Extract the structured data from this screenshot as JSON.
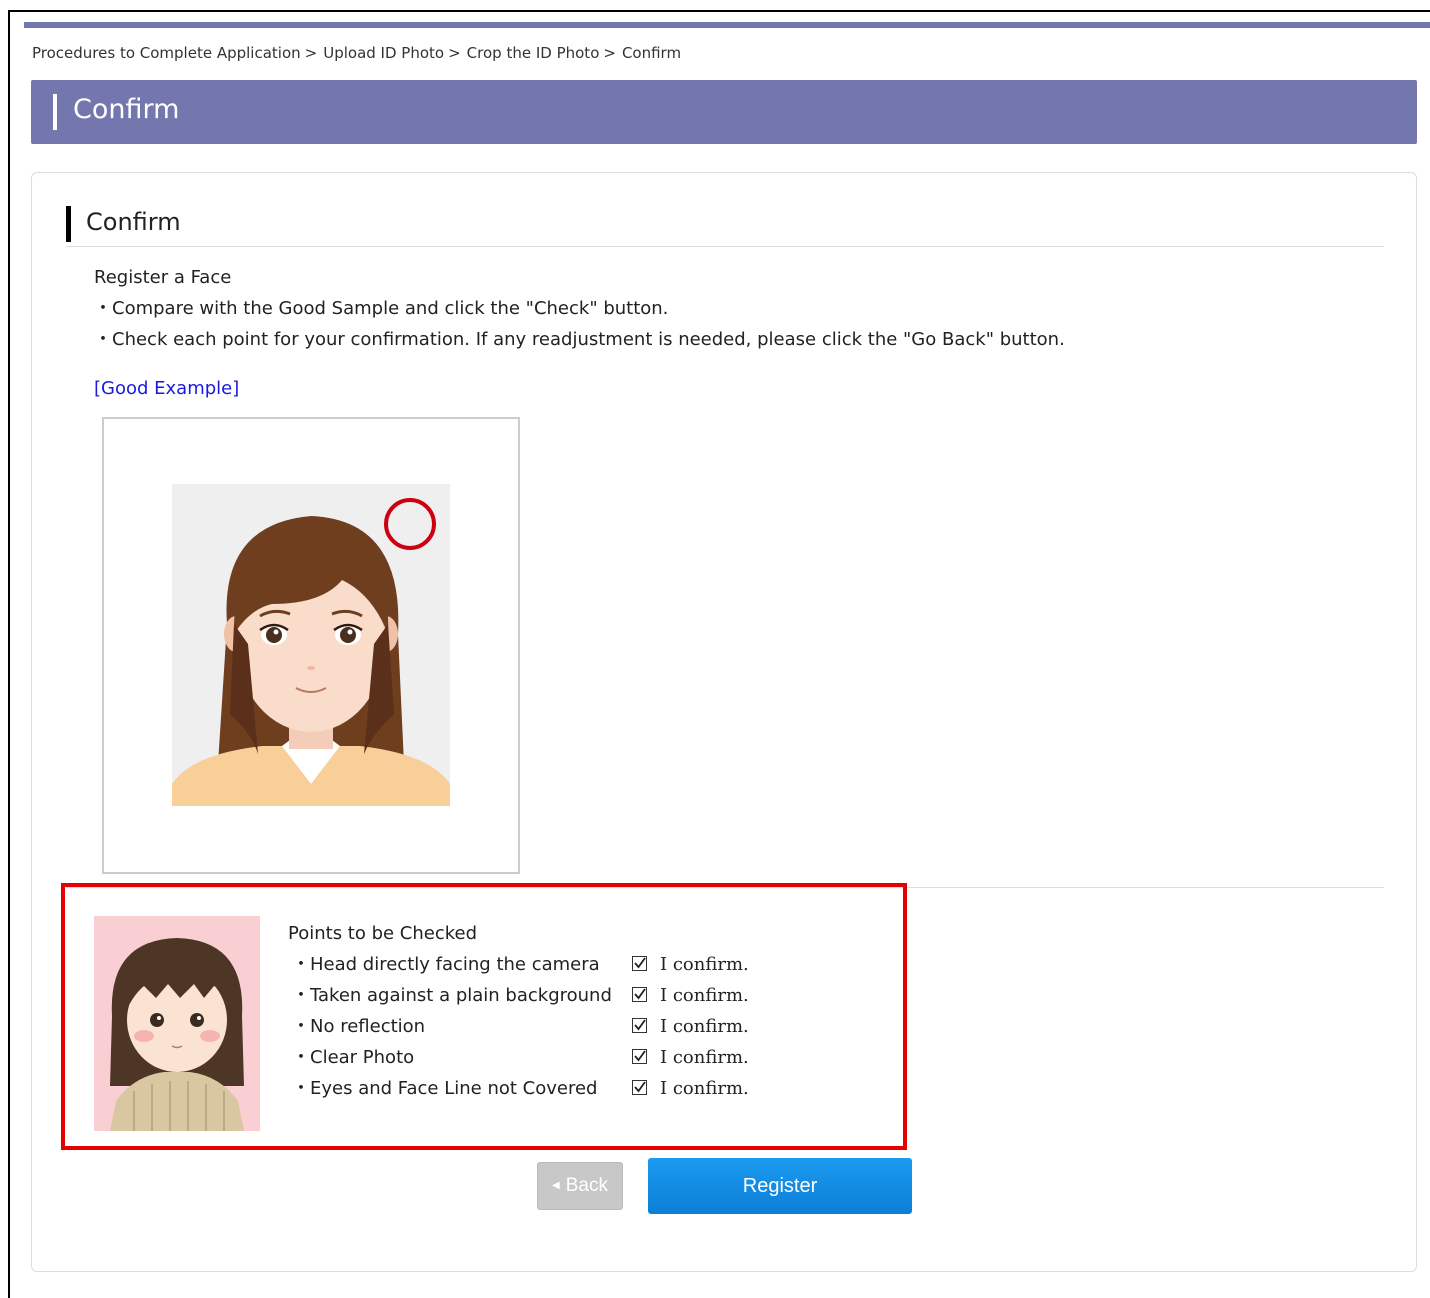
{
  "breadcrumb": {
    "items": [
      "Procedures to Complete Application",
      "Upload ID Photo",
      "Crop the ID Photo",
      "Confirm"
    ],
    "separator": ">"
  },
  "page_title": "Confirm",
  "section": {
    "title": "Confirm",
    "intro": {
      "heading": "Register a Face",
      "line1": "・Compare with the Good Sample and click the \"Check\" button.",
      "line2": "・Check each point for your confirmation. If any readjustment is needed, please click the \"Go Back\" button."
    },
    "good_example_link": "[Good Example]"
  },
  "checks": {
    "title": "Points to be Checked",
    "items": [
      {
        "label": "・Head directly facing the camera",
        "confirm": "I confirm.",
        "checked": true
      },
      {
        "label": "・Taken against a plain background",
        "confirm": "I confirm.",
        "checked": true
      },
      {
        "label": "・No reflection",
        "confirm": "I confirm.",
        "checked": true
      },
      {
        "label": "・Clear Photo",
        "confirm": "I confirm.",
        "checked": true
      },
      {
        "label": "・Eyes and Face Line not Covered",
        "confirm": "I confirm.",
        "checked": true
      }
    ]
  },
  "buttons": {
    "back": "Back",
    "register": "Register"
  },
  "colors": {
    "banner": "#7477ad",
    "highlight_border": "#e60000",
    "link": "#1a1adf",
    "register_button": "#1a9bf0"
  }
}
